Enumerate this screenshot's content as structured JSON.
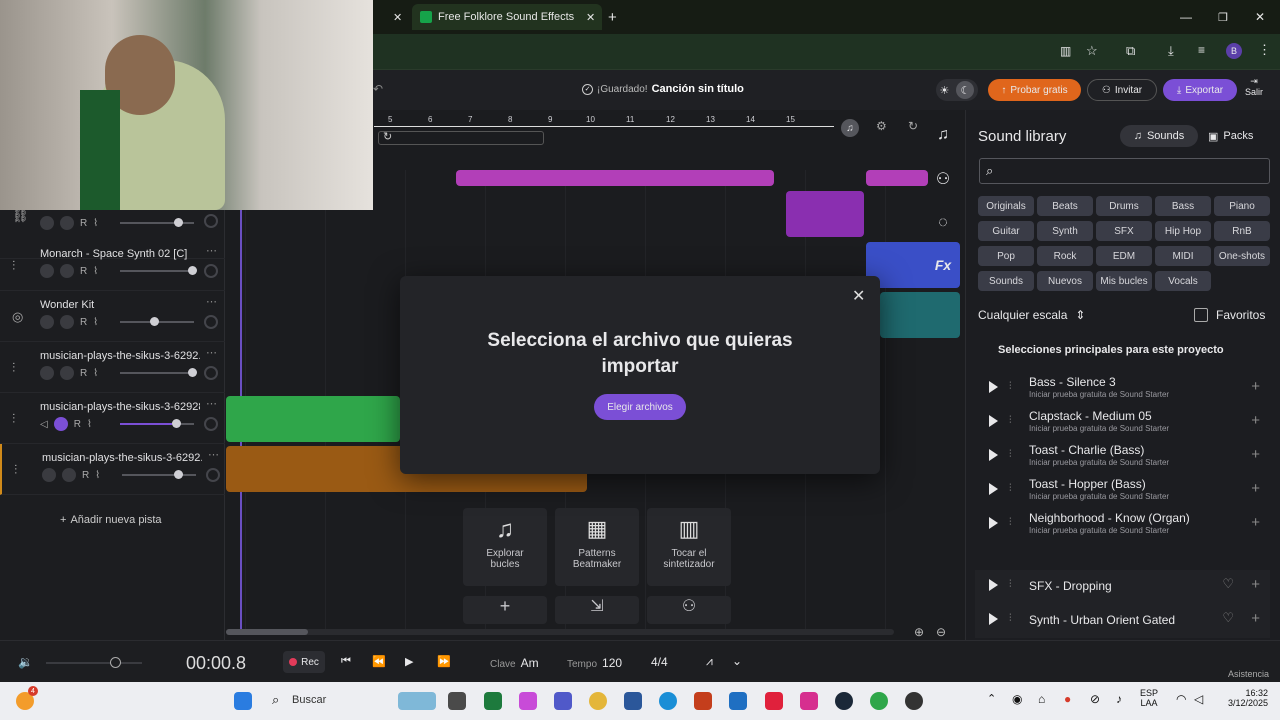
{
  "browser": {
    "tab_label": "Free Folklore Sound Effects Do",
    "profile_initial": "B"
  },
  "header": {
    "saved_text": "¡Guardado!",
    "song_title": "Canción sin título",
    "try_free": "Probar gratis",
    "invite": "Invitar",
    "export": "Exportar",
    "exit": "Salir"
  },
  "ruler": {
    "ticks": [
      "5",
      "6",
      "7",
      "8",
      "9",
      "10",
      "11",
      "12",
      "13",
      "14",
      "15"
    ]
  },
  "tracks": [
    {
      "name": "",
      "icon": "link-icon"
    },
    {
      "name": "Monarch - Space Synth 02 [C]",
      "icon": "waveform-icon"
    },
    {
      "name": "Wonder Kit",
      "icon": "drum-icon"
    },
    {
      "name": "musician-plays-the-sikus-3-6292...",
      "icon": "waveform-icon"
    },
    {
      "name": "musician-plays-the-sikus-3-62928",
      "icon": "waveform-icon"
    },
    {
      "name": "musician-plays-the-sikus-3-6292...",
      "icon": "waveform-icon"
    }
  ],
  "track_ctrl_r": "R",
  "add_track": "Añadir nueva pista",
  "modal": {
    "title": "Selecciona el archivo que quieras importar",
    "button": "Elegir archivos"
  },
  "tools": [
    {
      "label1": "Explorar",
      "label2": "bucles"
    },
    {
      "label1": "Patterns",
      "label2": "Beatmaker"
    },
    {
      "label1": "Tocar el",
      "label2": "sintetizador"
    }
  ],
  "library": {
    "title": "Sound library",
    "tab_sounds": "Sounds",
    "tab_packs": "Packs",
    "search_placeholder": "",
    "chips": [
      "Originals",
      "Beats",
      "Drums",
      "Bass",
      "Piano",
      "Guitar",
      "Synth",
      "SFX",
      "Hip Hop",
      "RnB",
      "Pop",
      "Rock",
      "EDM",
      "MIDI",
      "One-shots",
      "Sounds",
      "Nuevos",
      "Mis bucles",
      "Vocals"
    ],
    "scale_label": "Cualquier escala",
    "favorites_label": "Favoritos",
    "section_title": "Selecciones principales para este proyecto",
    "items": [
      {
        "title": "Bass - Silence 3",
        "sub": "Iniciar prueba gratuita de Sound Starter"
      },
      {
        "title": "Clapstack - Medium 05",
        "sub": "Iniciar prueba gratuita de Sound Starter"
      },
      {
        "title": "Toast - Charlie (Bass)",
        "sub": "Iniciar prueba gratuita de Sound Starter"
      },
      {
        "title": "Toast - Hopper (Bass)",
        "sub": "Iniciar prueba gratuita de Sound Starter"
      },
      {
        "title": "Neighborhood - Know (Organ)",
        "sub": "Iniciar prueba gratuita de Sound Starter"
      }
    ],
    "extra_items": [
      {
        "title": "SFX - Dropping"
      },
      {
        "title": "Synth - Urban Orient Gated"
      }
    ]
  },
  "transport": {
    "time": "00:00.8",
    "rec": "Rec",
    "key_label": "Clave",
    "key_value": "Am",
    "tempo_label": "Tempo",
    "tempo_value": "120",
    "signature": "4/4",
    "assist": "Asistencia"
  },
  "taskbar": {
    "search": "Buscar",
    "lang1": "ESP",
    "lang2": "LAA",
    "time": "16:32",
    "date": "3/12/2025",
    "badge": "4"
  },
  "colors": {
    "accent_purple": "#7b4fd6",
    "accent_orange": "#e0661c",
    "clip_pink": "#b23fb8",
    "clip_green": "#2fa64a",
    "clip_orange": "#9a5a14",
    "clip_blue": "#3a4fc7",
    "clip_teal": "#1f6a6f"
  }
}
